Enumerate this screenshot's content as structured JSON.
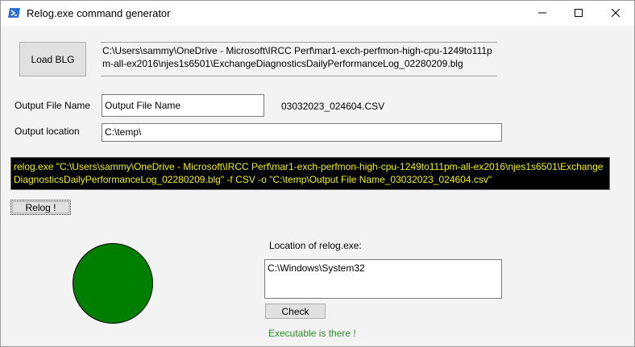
{
  "window": {
    "title": "Relog.exe command generator",
    "icon": "powershell-icon",
    "controls": {
      "minimize": "minimize-icon",
      "maximize": "maximize-icon",
      "close": "close-icon"
    }
  },
  "load_button": {
    "label": "Load BLG"
  },
  "blg_path": "C:\\Users\\sammy\\OneDrive - Microsoft\\IRCC Perf\\mar1-exch-perfmon-high-cpu-1249to111pm-all-ex2016\\njes1s6501\\ExchangeDiagnosticsDailyPerformanceLog_02280209.blg",
  "output_file": {
    "label": "Output File Name",
    "value": "Output File Name",
    "suffix": "03032023_024604.CSV"
  },
  "output_location": {
    "label": "Output location",
    "value": "C:\\temp\\"
  },
  "command": "relog.exe \"C:\\Users\\sammy\\OneDrive - Microsoft\\IRCC Perf\\mar1-exch-perfmon-high-cpu-1249to111pm-all-ex2016\\njes1s6501\\ExchangeDiagnosticsDailyPerformanceLog_02280209.blg\" -f CSV -o \"C:\\temp\\Output File Name_03032023_024604.csv\"",
  "relog_button": {
    "label": "Relog !"
  },
  "relog_location": {
    "label": "Location of relog.exe:",
    "value": "C:\\Windows\\System32"
  },
  "check_button": {
    "label": "Check"
  },
  "status": {
    "text": "Executable is there !",
    "indicator_color": "#007e00",
    "text_color": "#2a8a2a"
  }
}
